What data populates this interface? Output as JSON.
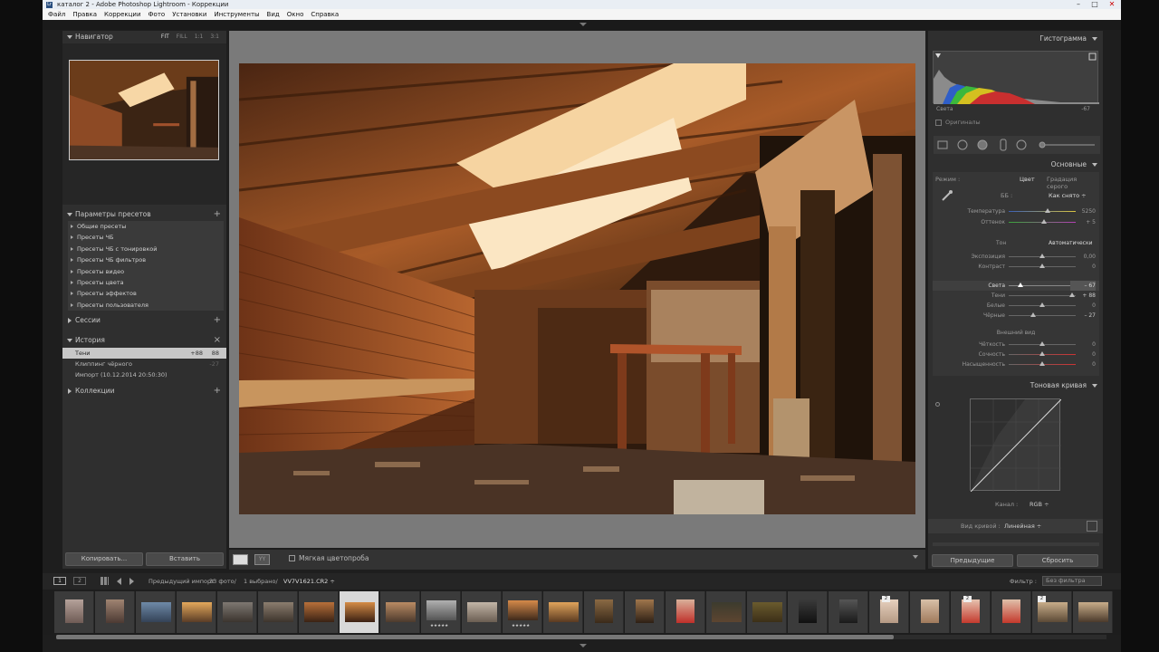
{
  "titlebar": {
    "title": "каталог 2 - Adobe Photoshop Lightroom - Коррекции",
    "app_icon": "Lr",
    "minimize": "–",
    "maximize": "□",
    "close": "✕"
  },
  "menu": [
    "Файл",
    "Правка",
    "Коррекции",
    "Фото",
    "Установки",
    "Инструменты",
    "Вид",
    "Окно",
    "Справка"
  ],
  "navigator": {
    "title": "Навигатор",
    "options": [
      "FIT",
      "FILL",
      "1:1",
      "3:1"
    ],
    "selected": "FIT"
  },
  "presets": {
    "title": "Параметры пресетов",
    "add": "+",
    "items": [
      "Общие пресеты",
      "Пресеты ЧБ",
      "Пресеты ЧБ с тонировкой",
      "Пресеты ЧБ фильтров",
      "Пресеты видео",
      "Пресеты цвета",
      "Пресеты эффектов",
      "Пресеты пользователя"
    ]
  },
  "sessions": {
    "title": "Сессии",
    "add": "+"
  },
  "history": {
    "title": "История",
    "close": "×",
    "items": [
      {
        "label": "Тени",
        "v1": "+88",
        "v2": "88"
      },
      {
        "label": "Клиппинг чёрного",
        "v1": "",
        "v2": "-27"
      },
      {
        "label": "Импорт (10.12.2014 20:50:30)",
        "v1": "",
        "v2": ""
      }
    ]
  },
  "collections": {
    "title": "Коллекции",
    "add": "+"
  },
  "left_buttons": {
    "copy": "Копировать...",
    "paste": "Вставить"
  },
  "toolbar": {
    "soft_proof": "Мягкая цветопроба",
    "view_btn": "YY"
  },
  "histogram": {
    "title": "Гистограмма",
    "label": "Света",
    "value": "-67",
    "originals": "Оригиналы"
  },
  "basic": {
    "title": "Основные",
    "treatment": {
      "label": "Режим :",
      "color": "Цвет",
      "bw": "Градация серого"
    },
    "wb": {
      "label": "ББ :",
      "value": "Как снято ÷"
    },
    "wb_sliders": [
      {
        "name": "Температура",
        "value": "5250",
        "pos": 0.58
      },
      {
        "name": "Оттенок",
        "value": "+ 5",
        "pos": 0.52
      }
    ],
    "tone_header": "Тон",
    "auto": "Автоматически",
    "tone_sliders": [
      {
        "name": "Экспозиция",
        "value": "0,00",
        "pos": 0.5
      },
      {
        "name": "Контраст",
        "value": "0",
        "pos": 0.5
      },
      {
        "name": "Света",
        "value": "– 67",
        "pos": 0.18
      },
      {
        "name": "Тени",
        "value": "+ 88",
        "pos": 0.94
      },
      {
        "name": "Белые",
        "value": "0",
        "pos": 0.5
      },
      {
        "name": "Чёрные",
        "value": "– 27",
        "pos": 0.37
      }
    ],
    "presence_header": "Внешний вид",
    "presence_sliders": [
      {
        "name": "Чёткость",
        "value": "0",
        "pos": 0.5
      },
      {
        "name": "Сочность",
        "value": "0",
        "pos": 0.5
      },
      {
        "name": "Насыщенность",
        "value": "0",
        "pos": 0.5
      }
    ]
  },
  "tone_curve": {
    "title": "Тоновая кривая",
    "channel_label": "Канал :",
    "channel": "RGB ÷",
    "curve_label": "Вид кривой :",
    "curve": "Линейная ÷"
  },
  "right_buttons": {
    "previous": "Предыдущие",
    "reset": "Сбросить"
  },
  "filmbar": {
    "pages": [
      "1",
      "2"
    ],
    "source": "Предыдущий импорт",
    "count": "33 фото/",
    "selected": "1 выбрано/",
    "filename": "VV7V1621.CR2 ÷",
    "filter_label": "Фильтр :",
    "filter_value": "Без фильтра"
  },
  "film_badges": [
    "★★★★★",
    "★★★★★",
    "2",
    "2",
    "2"
  ],
  "colors": {
    "accent": "#d6c9a5",
    "panel": "#2f2f2f",
    "bg": "#1e1e1e",
    "slider_knob": "#bbbbbb"
  }
}
